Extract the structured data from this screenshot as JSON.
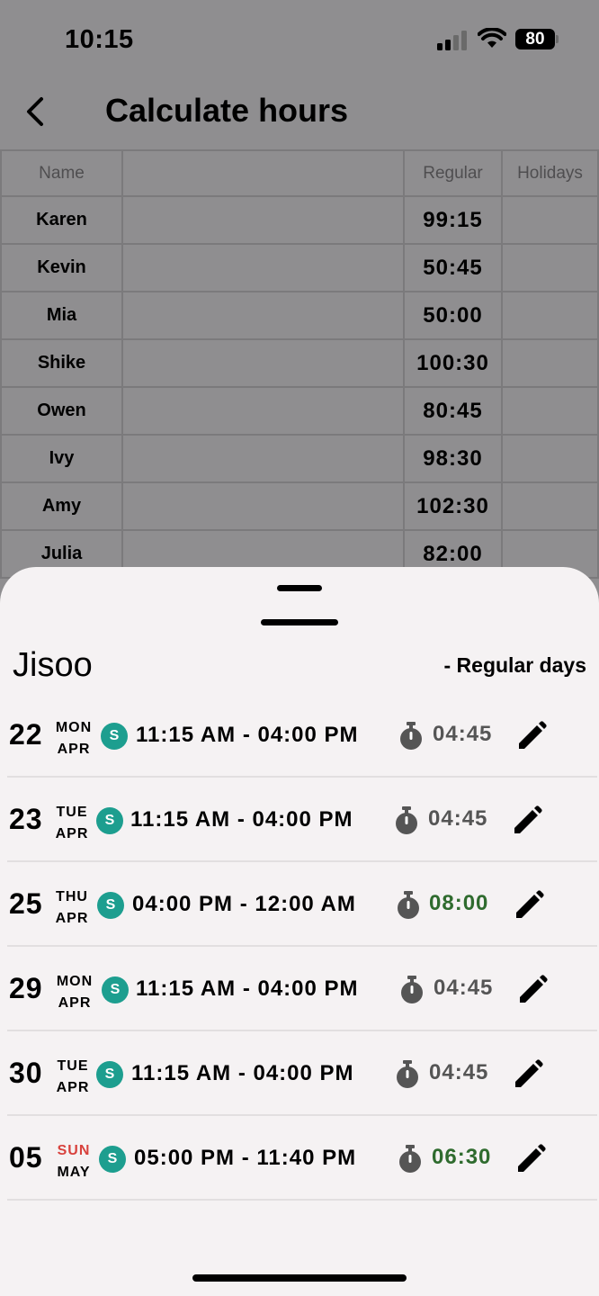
{
  "status_bar": {
    "time": "10:15",
    "battery": "80"
  },
  "header": {
    "title": "Calculate hours"
  },
  "table": {
    "columns": [
      "Name",
      "",
      "Regular",
      "Holidays"
    ],
    "rows": [
      {
        "name": "Karen",
        "regular": "99:15",
        "holidays": ""
      },
      {
        "name": "Kevin",
        "regular": "50:45",
        "holidays": ""
      },
      {
        "name": "Mia",
        "regular": "50:00",
        "holidays": ""
      },
      {
        "name": "Shike",
        "regular": "100:30",
        "holidays": ""
      },
      {
        "name": "Owen",
        "regular": "80:45",
        "holidays": ""
      },
      {
        "name": "Ivy",
        "regular": "98:30",
        "holidays": ""
      },
      {
        "name": "Amy",
        "regular": "102:30",
        "holidays": ""
      },
      {
        "name": "Julia",
        "regular": "82:00",
        "holidays": ""
      }
    ]
  },
  "sheet": {
    "employee": "Jisoo",
    "day_type": "- Regular days",
    "entries": [
      {
        "day": "22",
        "dow": "MON",
        "month": "APR",
        "badge": "S",
        "range": "11:15 AM - 04:00 PM",
        "duration": "04:45"
      },
      {
        "day": "23",
        "dow": "TUE",
        "month": "APR",
        "badge": "S",
        "range": "11:15 AM - 04:00 PM",
        "duration": "04:45"
      },
      {
        "day": "25",
        "dow": "THU",
        "month": "APR",
        "badge": "S",
        "range": "04:00 PM - 12:00 AM",
        "duration": "08:00"
      },
      {
        "day": "29",
        "dow": "MON",
        "month": "APR",
        "badge": "S",
        "range": "11:15 AM - 04:00 PM",
        "duration": "04:45"
      },
      {
        "day": "30",
        "dow": "TUE",
        "month": "APR",
        "badge": "S",
        "range": "11:15 AM - 04:00 PM",
        "duration": "04:45"
      },
      {
        "day": "05",
        "dow": "SUN",
        "month": "MAY",
        "badge": "S",
        "range": "05:00 PM - 11:40 PM",
        "duration": "06:30"
      }
    ]
  },
  "colors": {
    "badge": "#1d9e8f",
    "sunday": "#d8423d",
    "long_duration": "#2f6b2e",
    "overlay": "#8f8e90",
    "sheet": "#f5f2f3"
  },
  "icons": [
    "back-arrow-icon",
    "signal-icon",
    "wifi-icon",
    "battery-icon",
    "stopwatch-icon",
    "pencil-icon"
  ]
}
